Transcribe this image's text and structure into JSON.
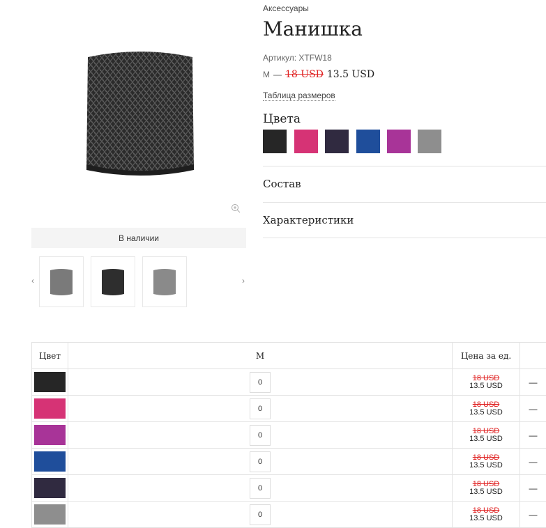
{
  "breadcrumb": "Аксессуары",
  "product": {
    "title": "Манишка",
    "sku": "Артикул: XTFW18",
    "size": "M",
    "dash": "—",
    "old_price": "18 USD",
    "new_price": "13.5 USD",
    "size_table_link": "Таблица размеров",
    "colors_label": "Цвета",
    "colors": [
      "#262626",
      "#d63375",
      "#302a40",
      "#1f4e9b",
      "#a83498",
      "#8e8e8e"
    ],
    "accordions": [
      "Состав",
      "Характеристики"
    ]
  },
  "gallery": {
    "stock_label": "В наличии",
    "prev_arrow": "‹",
    "next_arrow": "›",
    "thumb_colors": [
      "#7a7a7a",
      "#2e2e2e",
      "#8a8a8a"
    ]
  },
  "table": {
    "headers": {
      "color": "Цвет",
      "size": "M",
      "unit_price": "Цена за ед."
    },
    "rows": [
      {
        "color": "#262626",
        "qty": "0",
        "old": "18 USD",
        "new": "13.5 USD",
        "total": "—"
      },
      {
        "color": "#d63375",
        "qty": "0",
        "old": "18 USD",
        "new": "13.5 USD",
        "total": "—"
      },
      {
        "color": "#a83498",
        "qty": "0",
        "old": "18 USD",
        "new": "13.5 USD",
        "total": "—"
      },
      {
        "color": "#1f4e9b",
        "qty": "0",
        "old": "18 USD",
        "new": "13.5 USD",
        "total": "—"
      },
      {
        "color": "#302a40",
        "qty": "0",
        "old": "18 USD",
        "new": "13.5 USD",
        "total": "—"
      },
      {
        "color": "#8e8e8e",
        "qty": "0",
        "old": "18 USD",
        "new": "13.5 USD",
        "total": "—"
      }
    ]
  }
}
